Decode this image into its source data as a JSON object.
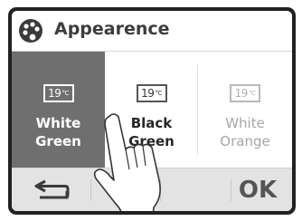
{
  "header": {
    "title": "Appearence",
    "icon": "palette-icon"
  },
  "options": [
    {
      "thermo_value": "19",
      "thermo_sub": "°C",
      "line1": "White",
      "line2": "Green",
      "selected": true
    },
    {
      "thermo_value": "19",
      "thermo_sub": "°C",
      "line1": "Black",
      "line2": "Green",
      "selected": false
    },
    {
      "thermo_value": "19",
      "thermo_sub": "°C",
      "line1": "White",
      "line2": "Orange",
      "selected": false
    }
  ],
  "footer": {
    "back_icon": "back-arrow-icon",
    "ok_label": "OK"
  },
  "colors": {
    "selected_bg": "#6f6f6f",
    "footer_bg": "#e3e3e3",
    "frame": "#222222"
  }
}
